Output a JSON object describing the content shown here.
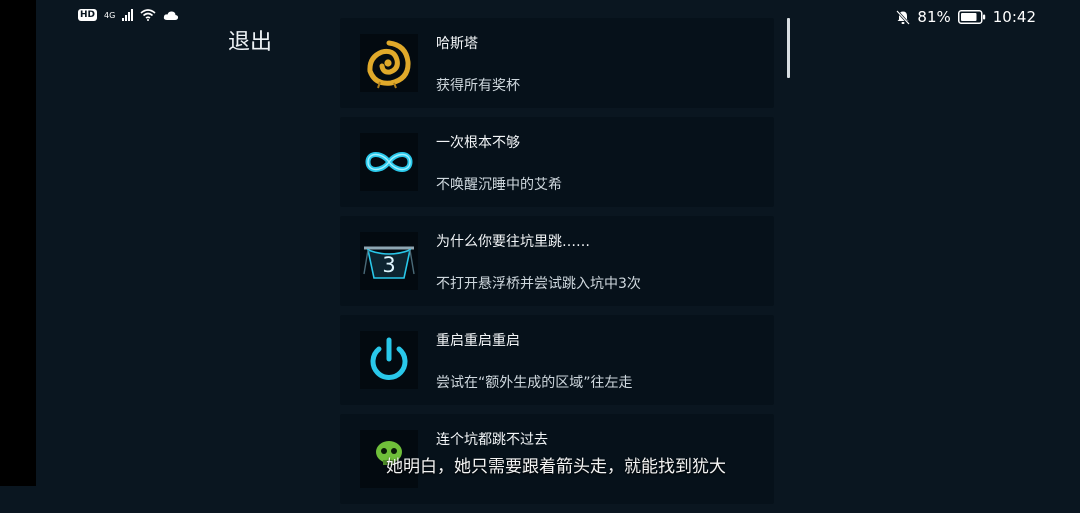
{
  "status_bar": {
    "hd": "HD",
    "network": "4G",
    "battery": "81%",
    "time": "10:42",
    "icons": [
      "hd-icon",
      "signal-icon",
      "wifi-icon",
      "cloud-icon",
      "mute-icon",
      "battery-icon"
    ]
  },
  "exit_label": "退出",
  "achievements": [
    {
      "title": "哈斯塔",
      "description": "获得所有奖杯",
      "icon": "hastur-sigil-icon"
    },
    {
      "title": "一次根本不够",
      "description": "不唤醒沉睡中的艾希",
      "icon": "infinity-icon"
    },
    {
      "title": "为什么你要往坑里跳……",
      "description": "不打开悬浮桥并尝试跳入坑中3次",
      "icon": "pit-three-icon",
      "icon_text": "3"
    },
    {
      "title": "重启重启重启",
      "description": "尝试在“额外生成的区域”往左走",
      "icon": "power-icon"
    },
    {
      "title": "连个坑都跳不过去",
      "description": "",
      "icon": "skull-icon"
    }
  ],
  "subtitle": "她明白，她只需要跟着箭头走，就能找到犹大",
  "colors": {
    "background": "#0a1620",
    "card": "#06111a",
    "cyan_accent": "#29c8ea",
    "gold_accent": "#e0a92a",
    "green_accent": "#6fbf3a"
  }
}
